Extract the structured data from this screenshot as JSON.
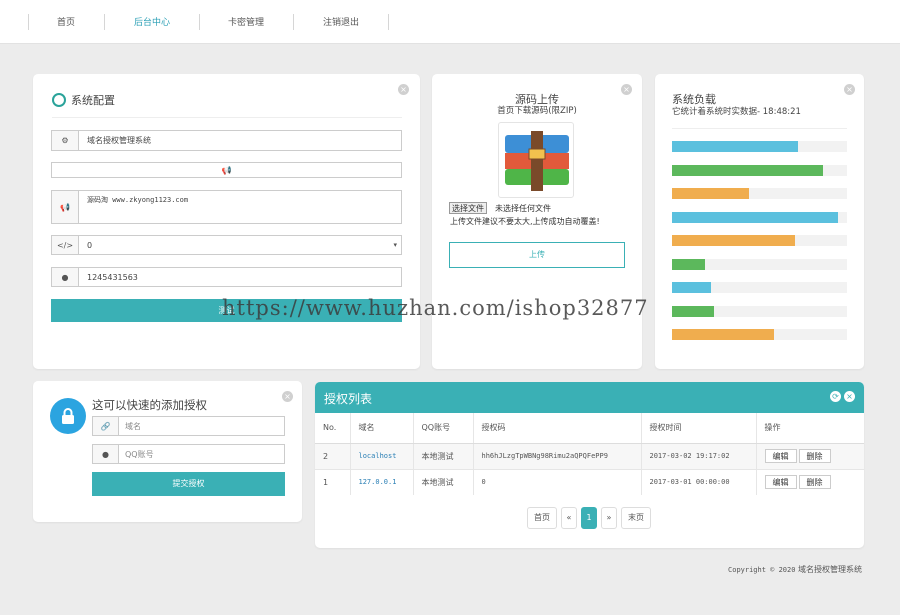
{
  "nav": {
    "items": [
      {
        "label": "首页"
      },
      {
        "label": "后台中心",
        "active": true
      },
      {
        "label": "卡密管理"
      },
      {
        "label": "注销退出"
      }
    ]
  },
  "config": {
    "title": "系统配置",
    "site_name": "域名授权管理系统",
    "notice_text": "源码淘 www.zkyong1123.com",
    "select_value": "0",
    "qq_value": "1245431563",
    "submit_label": "测试"
  },
  "upload": {
    "title": "源码上传",
    "subtitle": "首页下载源码(限ZIP)",
    "choose_file_label": "选择文件",
    "no_file_text": "未选择任何文件",
    "hint": "上传文件建议不要太大,上传成功自动覆盖!",
    "upload_label": "上传"
  },
  "load": {
    "title": "系统负载",
    "subtitle": "它统计着系统时实数据- 18:48:21",
    "bars": [
      {
        "pct": 72,
        "color": "#5bc0de"
      },
      {
        "pct": 86,
        "color": "#5cb85c"
      },
      {
        "pct": 44,
        "color": "#f0ad4e"
      },
      {
        "pct": 95,
        "color": "#5bc0de"
      },
      {
        "pct": 70,
        "color": "#f0ad4e"
      },
      {
        "pct": 19,
        "color": "#5cb85c"
      },
      {
        "pct": 22,
        "color": "#5bc0de"
      },
      {
        "pct": 24,
        "color": "#5cb85c"
      },
      {
        "pct": 58,
        "color": "#f0ad4e"
      }
    ]
  },
  "add": {
    "title": "这可以快速的添加授权",
    "domain_placeholder": "域名",
    "qq_placeholder": "QQ账号",
    "submit_label": "提交授权"
  },
  "table": {
    "title": "授权列表",
    "headers": [
      "No.",
      "域名",
      "QQ账号",
      "授权码",
      "授权时间",
      "操作"
    ],
    "rows": [
      {
        "no": "2",
        "domain": "localhost",
        "qq": "本地测试",
        "code": "hh6hJLzgTpWBNg98Rimu2aQPQFePP9",
        "time": "2017-03-02 19:17:02"
      },
      {
        "no": "1",
        "domain": "127.0.0.1",
        "qq": "本地测试",
        "code": "0",
        "time": "2017-03-01 00:00:00"
      }
    ],
    "edit_label": "编辑",
    "delete_label": "删除"
  },
  "pagination": {
    "first": "首页",
    "prev": "«",
    "current": "1",
    "next": "»",
    "last": "末页"
  },
  "footer": {
    "copyright": "Copyright © 2020",
    "name": "域名授权管理系统"
  },
  "watermark": "https://www.huzhan.com/ishop32877"
}
